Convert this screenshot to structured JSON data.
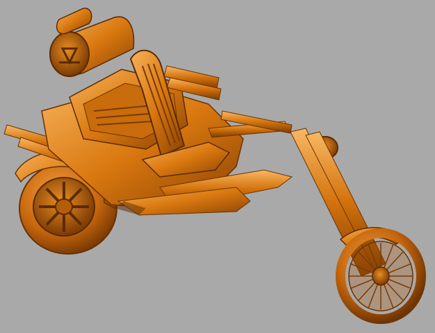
{
  "scene": {
    "subject": "trike-3d-render",
    "colors": {
      "background": "#a9a9a9",
      "body_light": "#f7b25a",
      "body_mid": "#d9780f",
      "body_dark": "#8a4304",
      "body_shadow": "#5a2a02"
    }
  }
}
